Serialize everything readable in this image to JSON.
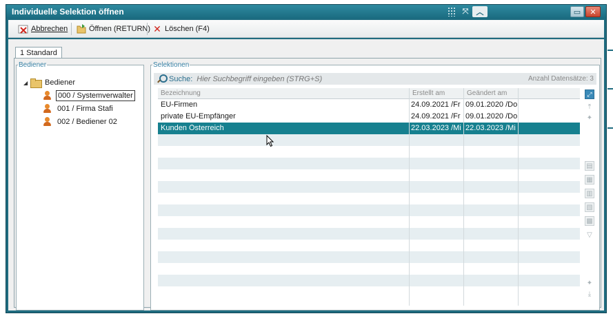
{
  "window": {
    "title": "Individuelle Selektion öffnen"
  },
  "toolbar": {
    "cancel_label": "Abbrechen",
    "open_label": "Öffnen (RETURN)",
    "delete_label": "Löschen (F4)"
  },
  "tabs": [
    {
      "label": "1 Standard",
      "selected": true
    }
  ],
  "bediener": {
    "legend": "Bediener",
    "root_label": "Bediener",
    "users": [
      {
        "label": "000 / Systemverwalter",
        "selected": true
      },
      {
        "label": "001 / Firma Stafi",
        "selected": false
      },
      {
        "label": "002 / Bediener 02",
        "selected": false
      }
    ]
  },
  "selektionen": {
    "legend": "Selektionen",
    "search_label": "Suche:",
    "search_placeholder": "Hier Suchbegriff eingeben (STRG+S)",
    "count_text": "Anzahl Datensätze: 3",
    "columns": [
      "Bezeichnung",
      "Erstellt am",
      "Geändert am"
    ],
    "rows": [
      {
        "bezeichnung": "EU-Firmen",
        "erstellt": "24.09.2021 /Fr",
        "geaendert": "09.01.2020 /Do",
        "selected": false
      },
      {
        "bezeichnung": "private EU-Empfänger",
        "erstellt": "24.09.2021 /Fr",
        "geaendert": "09.01.2020 /Do",
        "selected": false
      },
      {
        "bezeichnung": "Kunden Österreich",
        "erstellt": "22.03.2023 /Mi",
        "geaendert": "22.03.2023 /Mi",
        "selected": true
      }
    ]
  },
  "colors": {
    "title_bar": "#1f6c80",
    "selection": "#16808f",
    "accent_text": "#3a83a6"
  }
}
